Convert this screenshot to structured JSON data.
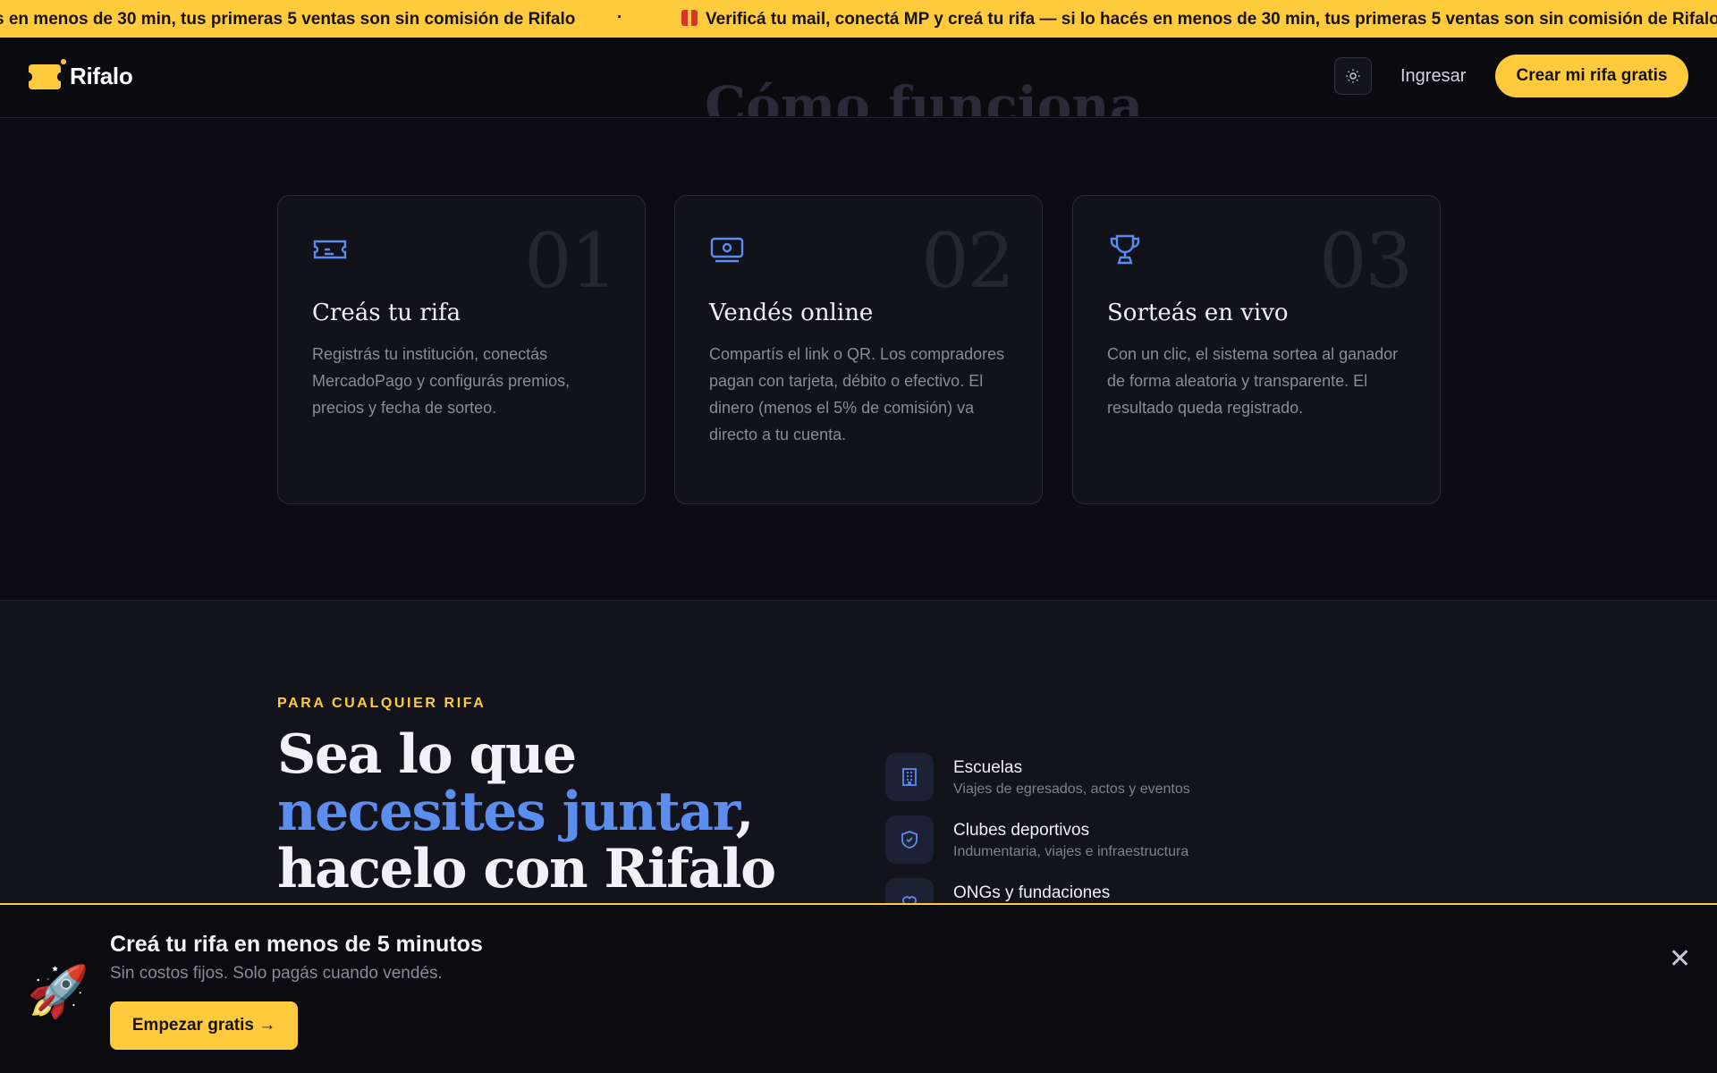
{
  "ticker": {
    "text_left": "s en menos de 30 min, tus primeras 5 ventas son sin comisión de Rifalo",
    "separator": "·",
    "text_right": "Verificá tu mail, conectá MP y creá tu rifa — si lo hacés en menos de 30 min, tus primeras 5 ventas son sin comisión de Rifalo",
    "icon": "gift-icon"
  },
  "nav": {
    "brand": "Rifalo",
    "login_label": "Ingresar",
    "cta_label": "Crear mi rifa gratis",
    "theme_icon": "sun-icon"
  },
  "steps": {
    "heading": "Cómo funciona",
    "items": [
      {
        "number": "01",
        "title": "Creás tu rifa",
        "description": "Registrás tu institución, conectás MercadoPago y configurás premios, precios y fecha de sorteo.",
        "icon": "ticket-icon"
      },
      {
        "number": "02",
        "title": "Vendés online",
        "description": "Compartís el link o QR. Los compradores pagan con tarjeta, débito o efectivo. El dinero (menos el 5% de comisión) va directo a tu cuenta.",
        "icon": "cash-icon"
      },
      {
        "number": "03",
        "title": "Sorteás en vivo",
        "description": "Con un clic, el sistema sortea al ganador de forma aleatoria y transparente. El resultado queda registrado.",
        "icon": "trophy-icon"
      }
    ]
  },
  "uses": {
    "eyebrow": "PARA CUALQUIER RIFA",
    "title_line1": "Sea lo que",
    "title_accent": "necesites juntar",
    "title_comma": ",",
    "title_line3": "hacelo con Rifalo",
    "items": [
      {
        "name": "Escuelas",
        "sub": "Viajes de egresados, actos y eventos",
        "icon": "building-icon"
      },
      {
        "name": "Clubes deportivos",
        "sub": "Indumentaria, viajes e infraestructura",
        "icon": "shield-icon"
      },
      {
        "name": "ONGs y fundaciones",
        "sub": "",
        "icon": "heart-icon"
      }
    ]
  },
  "promo": {
    "title": "Creá tu rifa en menos de 5 minutos",
    "subtitle": "Sin costos fijos. Solo pagás cuando vendés.",
    "button": "Empezar gratis →",
    "close": "✕"
  },
  "colors": {
    "accent": "#ffcb3d",
    "blue": "#5b8def",
    "background": "#0c0c12"
  }
}
